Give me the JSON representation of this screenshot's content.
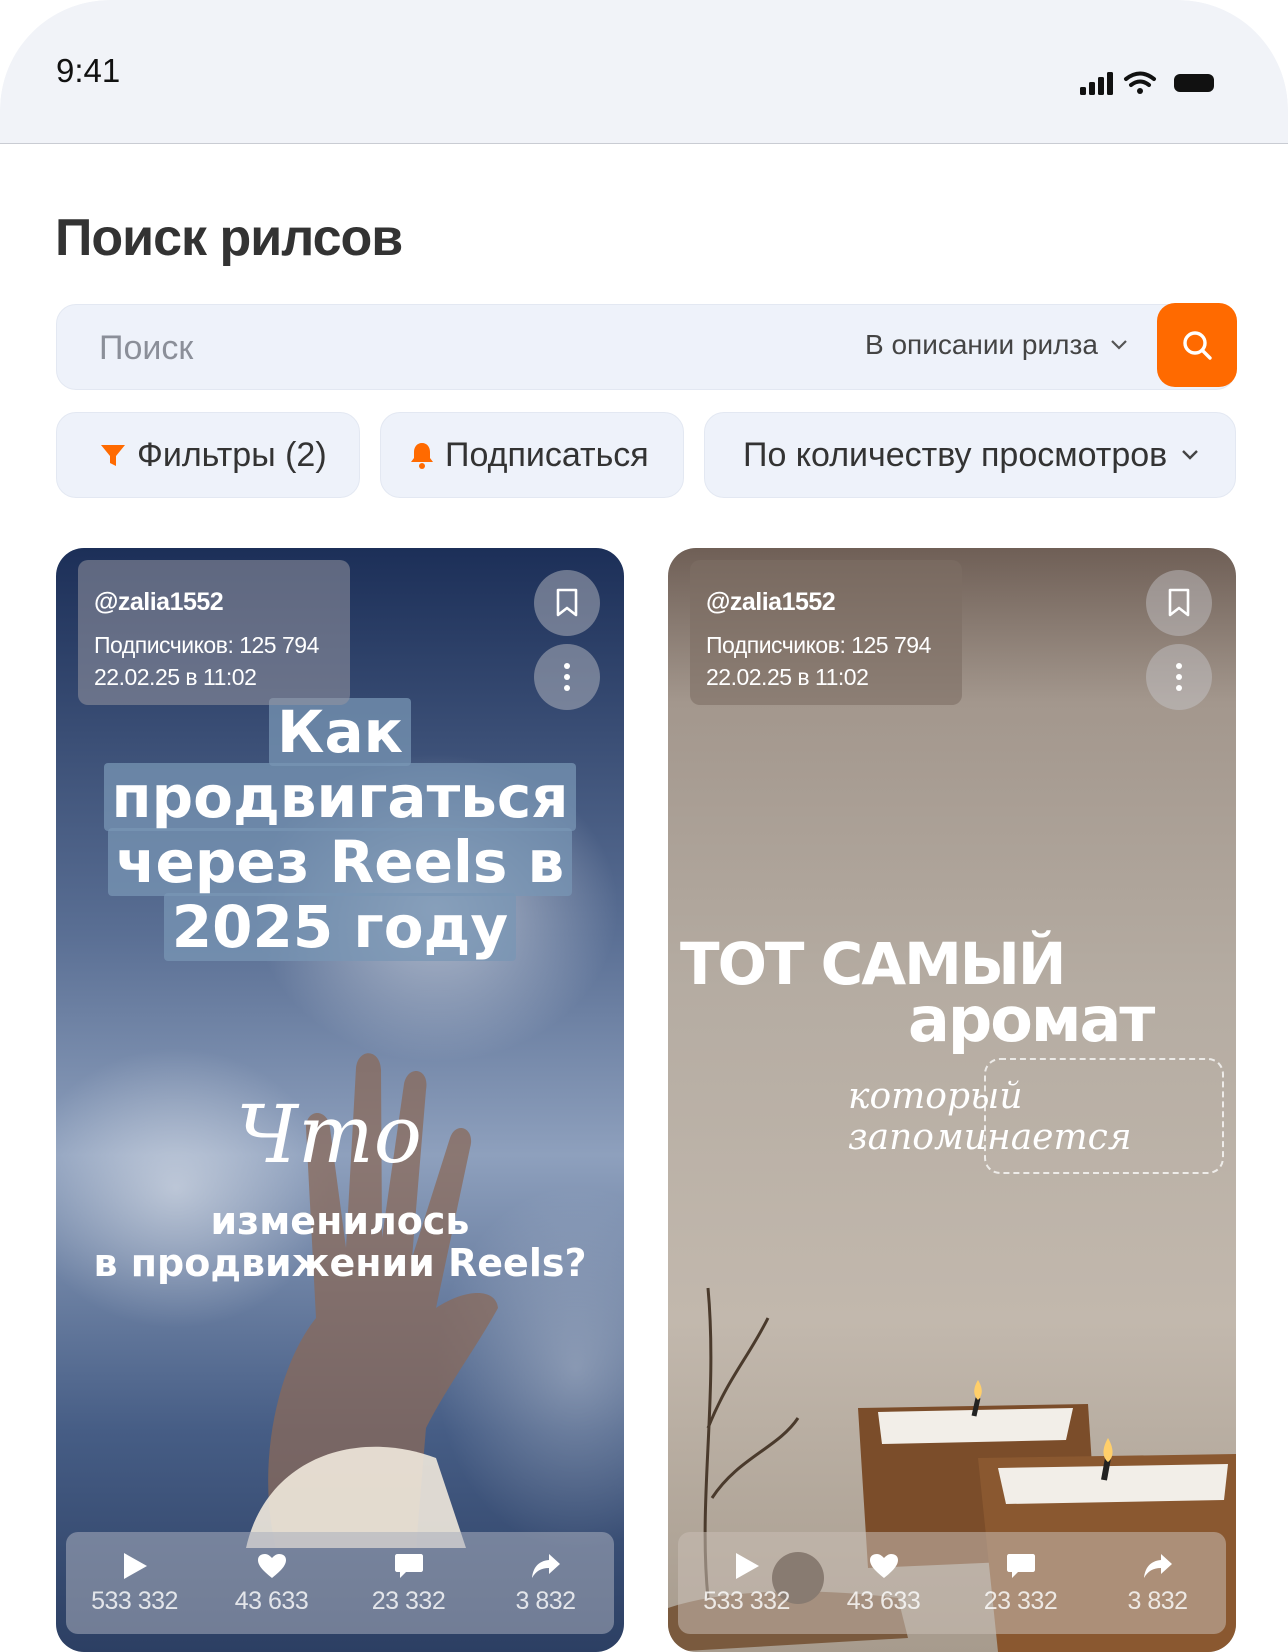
{
  "status_bar": {
    "time": "9:41"
  },
  "page": {
    "title": "Поиск рилсов"
  },
  "search": {
    "placeholder": "Поиск",
    "scope": "В описании рилза"
  },
  "chips": {
    "filters": "Фильтры (2)",
    "subscribe": "Подписаться",
    "sort": "По количеству просмотров"
  },
  "colors": {
    "accent": "#ff6a00",
    "surface": "#eef2fa"
  },
  "reels": [
    {
      "username": "@zalia1552",
      "subscribers": "Подписчиков: 125 794",
      "date": "22.02.25 в 11:02",
      "title_lines": [
        "Как",
        "продвигаться",
        "через Reels в",
        "2025 году"
      ],
      "script": "Что",
      "subtitle_lines": [
        "изменилось",
        "в продвижении Reels?"
      ],
      "stats": {
        "views": "533 332",
        "likes": "43 633",
        "comments": "23 332",
        "shares": "3 832"
      }
    },
    {
      "username": "@zalia1552",
      "subscribers": "Подписчиков: 125 794",
      "date": "22.02.25 в 11:02",
      "title_line_1": "ТОТ САМЫЙ",
      "title_line_2": "аромат",
      "script": "который запоминается",
      "stats": {
        "views": "533 332",
        "likes": "43 633",
        "comments": "23 332",
        "shares": "3 832"
      }
    }
  ]
}
